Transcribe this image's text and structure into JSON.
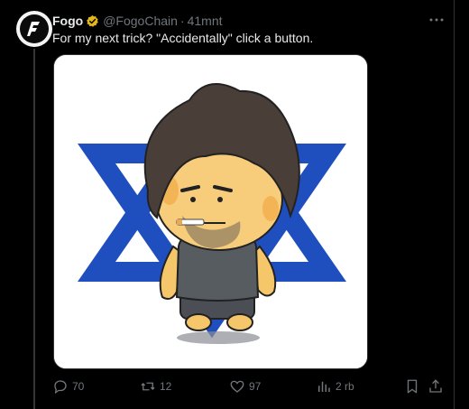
{
  "tweet": {
    "author": "Fogo",
    "handle": "@FogoChain",
    "separator": "·",
    "time": "41mnt",
    "text": "For my next trick? \"Accidentally\" click a button.",
    "avatar_glyph": "F",
    "image_alt": "Cartoon of a smoking chibi character in front of a blue star of David"
  },
  "actions": {
    "replies": "70",
    "reposts": "12",
    "likes": "97",
    "views": "2 rb"
  },
  "colors": {
    "background": "#000000",
    "text": "#e7e9ea",
    "muted": "#71767b",
    "verified_badge": "#e2b719",
    "star_blue": "#1f4fbf"
  },
  "icons": [
    "verified-badge-icon",
    "more-icon",
    "reply-icon",
    "repost-icon",
    "like-icon",
    "views-icon",
    "bookmark-icon",
    "share-icon"
  ]
}
